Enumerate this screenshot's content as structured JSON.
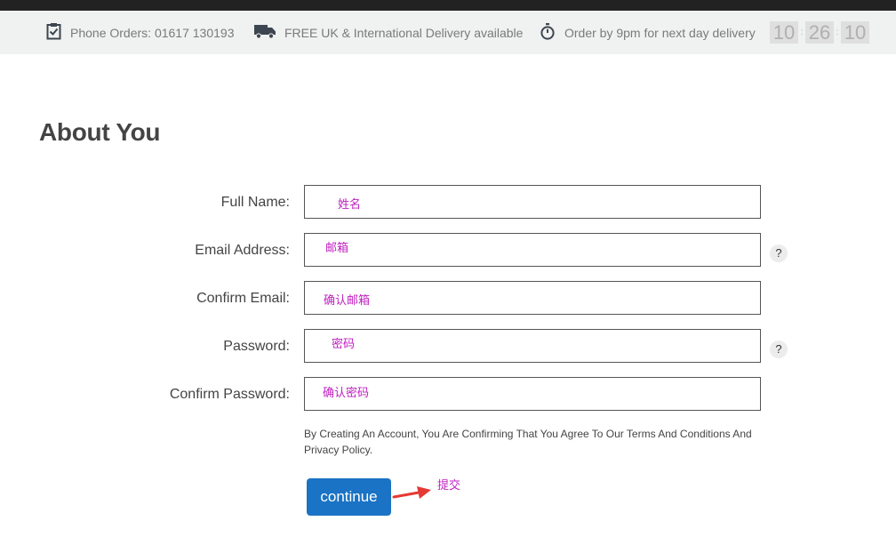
{
  "infobar": {
    "phone": "Phone Orders: 01617 130193",
    "delivery": "FREE UK & International Delivery available",
    "order_by": "Order by 9pm for next day delivery",
    "timer": {
      "hours": "10",
      "minutes": "26",
      "seconds": "10"
    },
    "icons": [
      "clipboard-check-icon",
      "truck-icon",
      "stopwatch-icon"
    ]
  },
  "form": {
    "heading": "About You",
    "fields": [
      {
        "label": "Full Name:",
        "annotation": "姓名",
        "help": null
      },
      {
        "label": "Email Address:",
        "annotation": "邮箱",
        "help": "?"
      },
      {
        "label": "Confirm Email:",
        "annotation": "确认邮箱",
        "help": null
      },
      {
        "label": "Password:",
        "annotation": "密码",
        "help": "?"
      },
      {
        "label": "Confirm Password:",
        "annotation": "确认密码",
        "help": null
      }
    ],
    "terms": "By Creating An Account, You Are Confirming That You Agree To Our Terms And Conditions And Privacy Policy.",
    "continue_label": "continue",
    "submit_annotation": "提交"
  },
  "colors": {
    "button": "#1a73c4",
    "annotation": "#c020c0",
    "arrow": "#e53935",
    "infobar_bg": "#f0f1f1",
    "topbar_bg": "#222222"
  }
}
